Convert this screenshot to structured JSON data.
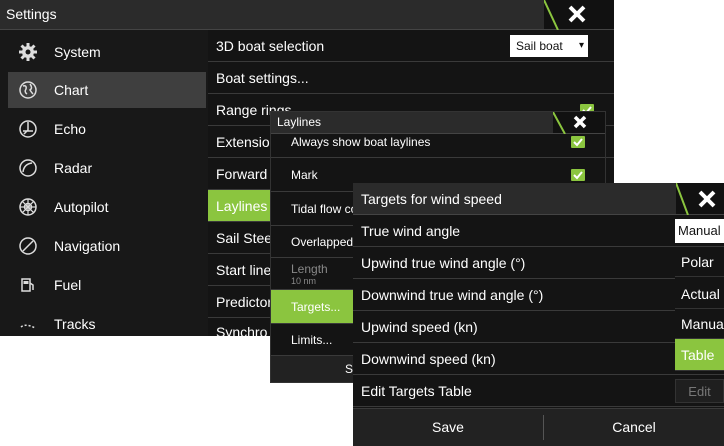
{
  "settings": {
    "title": "Settings",
    "sidebar": [
      {
        "label": "System",
        "icon": "gear-icon"
      },
      {
        "label": "Chart",
        "icon": "globe-icon"
      },
      {
        "label": "Echo",
        "icon": "sonar-icon"
      },
      {
        "label": "Radar",
        "icon": "radar-icon"
      },
      {
        "label": "Autopilot",
        "icon": "wheel-icon"
      },
      {
        "label": "Navigation",
        "icon": "compass-icon"
      },
      {
        "label": "Fuel",
        "icon": "fuel-pump-icon"
      },
      {
        "label": "Tracks",
        "icon": "track-icon"
      }
    ],
    "rows": [
      "3D boat selection",
      "Boat settings...",
      "Range rings",
      "Extensions",
      "Forward",
      "Laylines",
      "Sail Steer",
      "Start line",
      "Predictor",
      "Synchro"
    ],
    "boat_select_value": "Sail boat"
  },
  "laylines": {
    "title": "Laylines",
    "rows": [
      "Always show boat laylines",
      "Mark",
      "Tidal flow co",
      "Overlapped",
      "Length",
      "Targets...",
      "Limits..."
    ],
    "length_value": "10 nm",
    "save_partial": "Sa"
  },
  "targets": {
    "title": "Targets for wind speed",
    "rows": [
      "True wind angle",
      "Upwind true wind angle (°)",
      "Downwind true wind angle (°)",
      "Upwind speed (kn)",
      "Downwind speed (kn)",
      "Edit Targets Table"
    ],
    "current_value": "Manual",
    "options": [
      "Polar",
      "Actual",
      "Manual",
      "Table"
    ],
    "edit_label": "Edit",
    "save_label": "Save",
    "cancel_label": "Cancel"
  },
  "colors": {
    "accent": "#8bc53f",
    "panel": "#141414",
    "titlebar": "#2b2b2b"
  }
}
